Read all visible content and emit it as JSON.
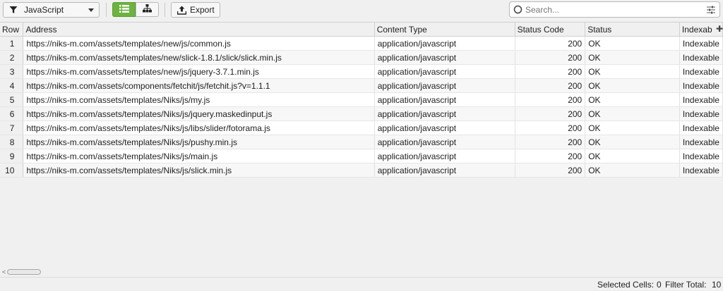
{
  "toolbar": {
    "filter_label": "JavaScript",
    "export_label": "Export",
    "search_placeholder": "Search...",
    "accent_color": "#6cb33f"
  },
  "table": {
    "columns": [
      "Row",
      "Address",
      "Content Type",
      "Status Code",
      "Status",
      "Indexab"
    ],
    "rows": [
      {
        "row": "1",
        "address": "https://niks-m.com/assets/templates/new/js/common.js",
        "content_type": "application/javascript",
        "status_code": "200",
        "status": "OK",
        "indexability": "Indexable"
      },
      {
        "row": "2",
        "address": "https://niks-m.com/assets/templates/new/slick-1.8.1/slick/slick.min.js",
        "content_type": "application/javascript",
        "status_code": "200",
        "status": "OK",
        "indexability": "Indexable"
      },
      {
        "row": "3",
        "address": "https://niks-m.com/assets/templates/new/js/jquery-3.7.1.min.js",
        "content_type": "application/javascript",
        "status_code": "200",
        "status": "OK",
        "indexability": "Indexable"
      },
      {
        "row": "4",
        "address": "https://niks-m.com/assets/components/fetchit/js/fetchit.js?v=1.1.1",
        "content_type": "application/javascript",
        "status_code": "200",
        "status": "OK",
        "indexability": "Indexable"
      },
      {
        "row": "5",
        "address": "https://niks-m.com/assets/templates/Niks/js/my.js",
        "content_type": "application/javascript",
        "status_code": "200",
        "status": "OK",
        "indexability": "Indexable"
      },
      {
        "row": "6",
        "address": "https://niks-m.com/assets/templates/Niks/js/jquery.maskedinput.js",
        "content_type": "application/javascript",
        "status_code": "200",
        "status": "OK",
        "indexability": "Indexable"
      },
      {
        "row": "7",
        "address": "https://niks-m.com/assets/templates/Niks/js/libs/slider/fotorama.js",
        "content_type": "application/javascript",
        "status_code": "200",
        "status": "OK",
        "indexability": "Indexable"
      },
      {
        "row": "8",
        "address": "https://niks-m.com/assets/templates/Niks/js/pushy.min.js",
        "content_type": "application/javascript",
        "status_code": "200",
        "status": "OK",
        "indexability": "Indexable"
      },
      {
        "row": "9",
        "address": "https://niks-m.com/assets/templates/Niks/js/main.js",
        "content_type": "application/javascript",
        "status_code": "200",
        "status": "OK",
        "indexability": "Indexable"
      },
      {
        "row": "10",
        "address": "https://niks-m.com/assets/templates/Niks/js/slick.min.js",
        "content_type": "application/javascript",
        "status_code": "200",
        "status": "OK",
        "indexability": "Indexable"
      }
    ]
  },
  "status_bar": {
    "selected_label": "Selected Cells:",
    "selected_value": "0",
    "filter_label": "Filter Total:",
    "filter_value": "10"
  }
}
